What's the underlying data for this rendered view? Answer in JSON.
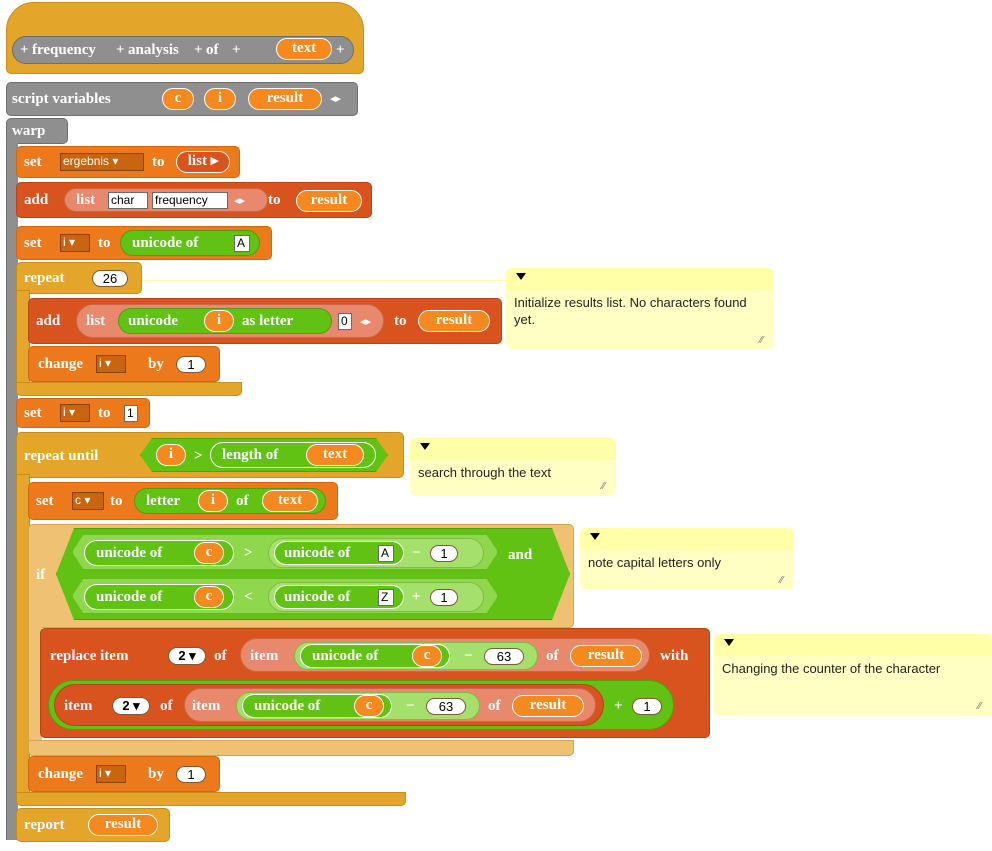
{
  "hat": {
    "words": [
      "frequency",
      "analysis",
      "of"
    ],
    "param": "text",
    "plus": "+"
  },
  "script_variables": {
    "label": "script variables",
    "vars": [
      "c",
      "i",
      "result"
    ],
    "arrows": "◂▸"
  },
  "warp": {
    "label": "warp"
  },
  "set_ergebnis": {
    "label_set": "set",
    "var": "ergebnis",
    "label_to": "to",
    "list_label": "list"
  },
  "add_header": {
    "label_add": "add",
    "list_label": "list",
    "items": [
      "char",
      "frequency"
    ],
    "label_to": "to",
    "target": "result"
  },
  "set_i_unicode": {
    "label_set": "set",
    "var": "i",
    "label_to": "to",
    "reporter": "unicode of",
    "value": "A"
  },
  "repeat26": {
    "label": "repeat",
    "count": "26"
  },
  "add_letter": {
    "label_add": "add",
    "list_label": "list",
    "unicode": "unicode",
    "var": "i",
    "as_letter": "as letter",
    "zero": "0",
    "label_to": "to",
    "target": "result"
  },
  "change_i_1": {
    "label": "change",
    "var": "i",
    "by": "by",
    "value": "1"
  },
  "set_i_1": {
    "label_set": "set",
    "var": "i",
    "label_to": "to",
    "value": "1"
  },
  "repeat_until": {
    "label": "repeat until",
    "var": "i",
    "op": ">",
    "length_of": "length of",
    "target": "text"
  },
  "set_c": {
    "label_set": "set",
    "var": "c",
    "label_to": "to",
    "letter": "letter",
    "idx": "i",
    "of": "of",
    "target": "text"
  },
  "if_block": {
    "label": "if",
    "and": "and",
    "cond1": {
      "unicode_of": "unicode of",
      "var": "c",
      "op": ">",
      "unicode_of2": "unicode of",
      "value": "A",
      "minus": "−",
      "num": "1"
    },
    "cond2": {
      "unicode_of": "unicode of",
      "var": "c",
      "op": "<",
      "unicode_of2": "unicode of",
      "value": "Z",
      "plus": "+",
      "num": "1"
    }
  },
  "replace": {
    "label": "replace item",
    "index": "2",
    "of": "of",
    "item": "item",
    "unicode_of": "unicode of",
    "var": "c",
    "minus": "−",
    "num": "63",
    "of2": "of",
    "target": "result",
    "with": "with"
  },
  "item_expr": {
    "item": "item",
    "index": "2",
    "of": "of",
    "item2": "item",
    "unicode_of": "unicode of",
    "var": "c",
    "minus": "−",
    "num": "63",
    "of2": "of",
    "target": "result",
    "plus": "+",
    "one": "1"
  },
  "change_i_1b": {
    "label": "change",
    "var": "i",
    "by": "by",
    "value": "1"
  },
  "report": {
    "label": "report",
    "target": "result"
  },
  "comments": [
    {
      "text": "Initialize results list. No characters found yet."
    },
    {
      "text": "search through the text"
    },
    {
      "text": "note capital letters only"
    },
    {
      "text": "Changing the counter of the character"
    }
  ]
}
